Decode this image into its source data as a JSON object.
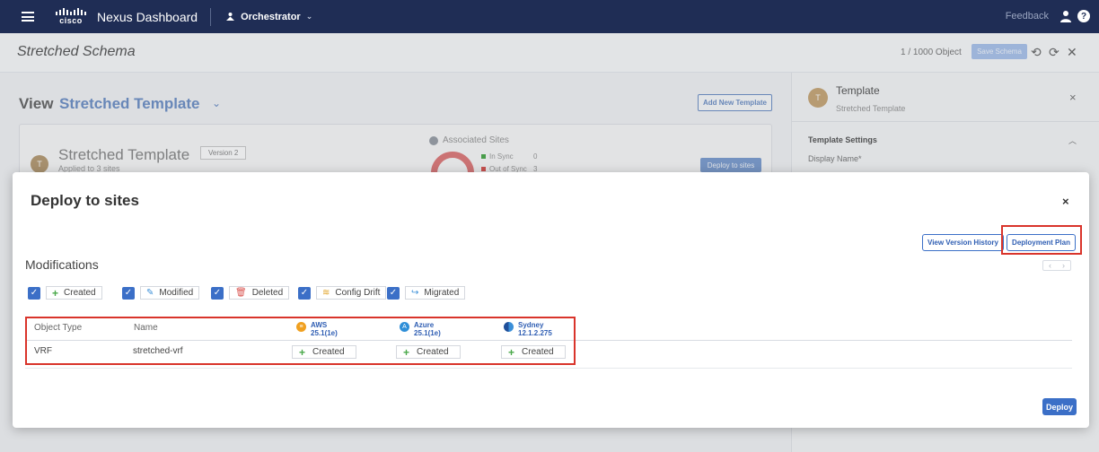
{
  "topbar": {
    "brand": "cisco",
    "app_name": "Nexus Dashboard",
    "service": "Orchestrator",
    "feedback": "Feedback",
    "help": "?"
  },
  "page": {
    "schema_title": "Stretched Schema",
    "object_count": "1 / 1000 Object",
    "save_label": "Save Schema",
    "view_label": "View",
    "view_name": "Stretched Template",
    "add_template": "Add New Template",
    "template_card": {
      "avatar": "T",
      "name": "Stretched Template",
      "version": "Version 2",
      "applied": "Applied to 3 sites",
      "associated_sites": "Associated Sites",
      "donut_value": "3",
      "in_sync_label": "In Sync",
      "in_sync_value": "0",
      "out_of_sync_label": "Out of Sync",
      "out_of_sync_value": "3",
      "deploy_to_sites": "Deploy to sites"
    }
  },
  "side_panel": {
    "avatar": "T",
    "title": "Template",
    "subtitle": "Stretched Template",
    "close": "×",
    "section": "Template Settings",
    "display_name_label": "Display Name*"
  },
  "modal": {
    "title": "Deploy to sites",
    "close": "×",
    "view_version_history": "View Version History",
    "deployment_plan": "Deployment Plan",
    "modifications_title": "Modifications",
    "filters": [
      {
        "label": "Created",
        "icon": "+"
      },
      {
        "label": "Modified",
        "icon": "✎"
      },
      {
        "label": "Deleted",
        "icon": "🗑"
      },
      {
        "label": "Config Drift",
        "icon": "≋"
      },
      {
        "label": "Migrated",
        "icon": "↪"
      }
    ],
    "table": {
      "col_object_type": "Object Type",
      "col_name": "Name",
      "sites": [
        {
          "name": "AWS",
          "version": "25.1(1e)",
          "color": "#f0a020"
        },
        {
          "name": "Azure",
          "version": "25.1(1e)",
          "color": "#2f8fd8"
        },
        {
          "name": "Sydney",
          "version": "12.1.2.275",
          "color": "#1f4f9a"
        }
      ],
      "rows": [
        {
          "object_type": "VRF",
          "name": "stretched-vrf",
          "site_status": [
            "Created",
            "Created",
            "Created"
          ]
        }
      ]
    },
    "deploy": "Deploy"
  },
  "colors": {
    "topbar_bg": "#1f2d55",
    "accent": "#3b6fc7",
    "highlight": "#d9342b",
    "created_icon": "#4aa94a"
  }
}
